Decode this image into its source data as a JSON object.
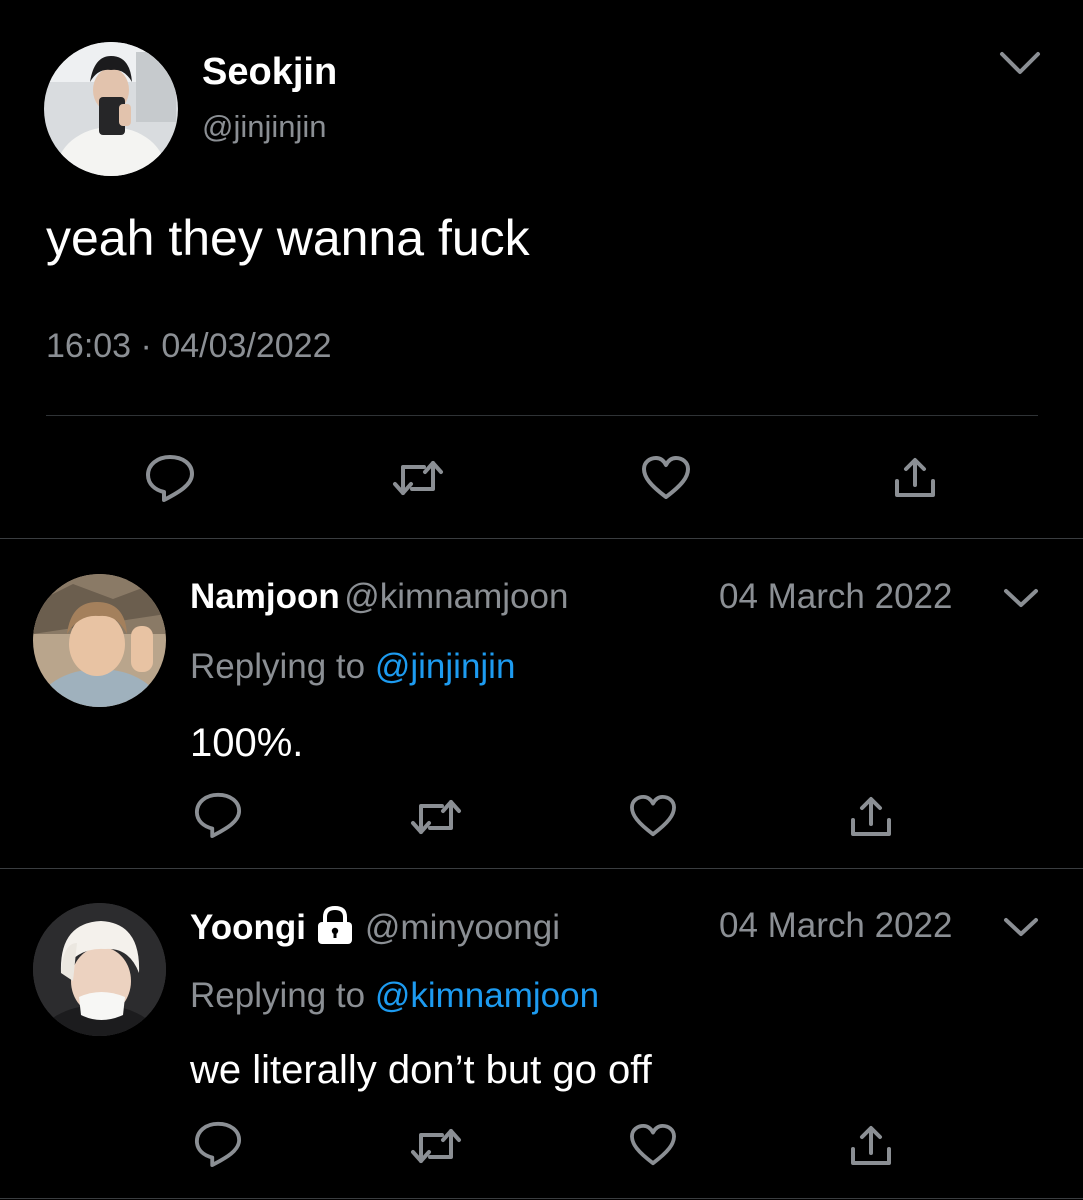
{
  "main_tweet": {
    "display_name": "Seokjin",
    "handle": "@jinjinjin",
    "text": "yeah they wanna fuck",
    "time": "16:03",
    "separator": "·",
    "date": "04/03/2022",
    "actions": [
      "reply-icon",
      "retweet-icon",
      "like-icon",
      "share-icon"
    ]
  },
  "replies": [
    {
      "display_name": "Namjoon",
      "handle": "@kimnamjoon",
      "date": "04 March 2022",
      "replying_prefix": "Replying to",
      "replying_to": "@jinjinjin",
      "text": "100%.",
      "protected": false
    },
    {
      "display_name": "Yoongi",
      "handle": "@minyoongi",
      "date": "04 March 2022",
      "replying_prefix": "Replying to",
      "replying_to": "@kimnamjoon",
      "text": "we literally don’t but go off",
      "protected": true
    }
  ],
  "colors": {
    "background": "#000000",
    "primary_text": "#ffffff",
    "secondary_text": "#8b8f94",
    "link": "#1d9bf0",
    "icon": "#8b8f94",
    "divider": "#2f3336"
  }
}
